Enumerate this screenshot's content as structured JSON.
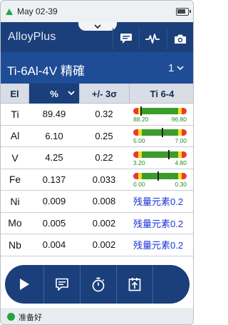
{
  "status_bar": {
    "date": "May 02-39"
  },
  "app": {
    "title": "AlloyPlus"
  },
  "grade": {
    "name": "Ti-6Al-4V 精確",
    "index": "1"
  },
  "table": {
    "headers": {
      "element": "El",
      "percent": "%",
      "error": "+/- 3σ",
      "grade": "Ti 6-4"
    },
    "rows": [
      {
        "el": "Ti",
        "pct": "89.49",
        "err": "0.32",
        "gauge": {
          "min": "88.20",
          "max": "96.80",
          "pos": 0.15
        }
      },
      {
        "el": "Al",
        "pct": "6.10",
        "err": "0.25",
        "gauge": {
          "min": "5.00",
          "max": "7.00",
          "pos": 0.55
        }
      },
      {
        "el": "V",
        "pct": "4.25",
        "err": "0.22",
        "gauge": {
          "min": "3.20",
          "max": "4.80",
          "pos": 0.66
        }
      },
      {
        "el": "Fe",
        "pct": "0.137",
        "err": "0.033",
        "gauge": {
          "min": "0.00",
          "max": "0.30",
          "pos": 0.46
        }
      },
      {
        "el": "Ni",
        "pct": "0.009",
        "err": "0.008",
        "residual": "残量元素0.2"
      },
      {
        "el": "Mo",
        "pct": "0.005",
        "err": "0.002",
        "residual": "残量元素0.2"
      },
      {
        "el": "Nb",
        "pct": "0.004",
        "err": "0.002",
        "residual": "残量元素0.2"
      }
    ]
  },
  "toolbar": {
    "buttons": [
      {
        "name": "play-button",
        "icon": "play-icon"
      },
      {
        "name": "comment-button",
        "icon": "comment-icon"
      },
      {
        "name": "timer-button",
        "icon": "stopwatch-icon"
      },
      {
        "name": "export-button",
        "icon": "export-icon"
      }
    ]
  },
  "footer": {
    "status": "准备好"
  },
  "colors": {
    "header": "#1b3f7a",
    "grade_bar": "#1e4d96",
    "ready": "#25a33f",
    "residual_text": "#1a33d6"
  }
}
